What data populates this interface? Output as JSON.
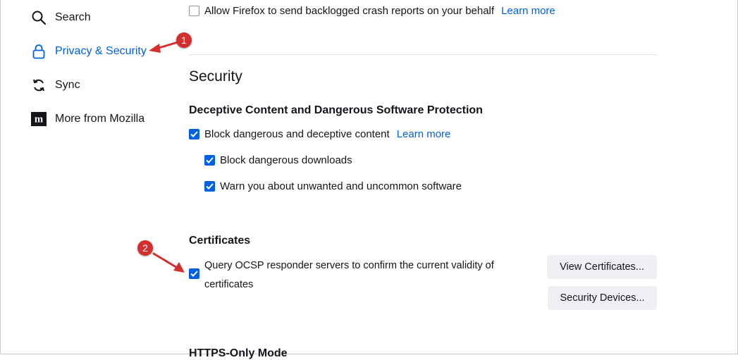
{
  "sidebar": {
    "items": [
      {
        "label": "Search",
        "icon": "search-icon"
      },
      {
        "label": "Privacy & Security",
        "icon": "lock-icon",
        "active": true
      },
      {
        "label": "Sync",
        "icon": "sync-icon"
      },
      {
        "label": "More from Mozilla",
        "icon": "mozilla-logo-icon"
      }
    ]
  },
  "crash_reports": {
    "label": "Allow Firefox to send backlogged crash reports on your behalf",
    "checked": false,
    "learn_more": "Learn more"
  },
  "security": {
    "title": "Security",
    "deceptive": {
      "heading": "Deceptive Content and Dangerous Software Protection",
      "block_content": {
        "label": "Block dangerous and deceptive content",
        "checked": true,
        "learn_more": "Learn more"
      },
      "block_downloads": {
        "label": "Block dangerous downloads",
        "checked": true
      },
      "warn_unwanted": {
        "label": "Warn you about unwanted and uncommon software",
        "checked": true
      }
    },
    "certificates": {
      "heading": "Certificates",
      "ocsp": {
        "label": "Query OCSP responder servers to confirm the current validity of certificates",
        "checked": true
      },
      "view_button": "View Certificates...",
      "devices_button": "Security Devices..."
    },
    "next_heading": "HTTPS-Only Mode"
  },
  "annotations": {
    "badge1": "1",
    "badge2": "2",
    "color": "#d32f2f"
  },
  "colors": {
    "accent": "#0060df",
    "text": "#15141a"
  }
}
